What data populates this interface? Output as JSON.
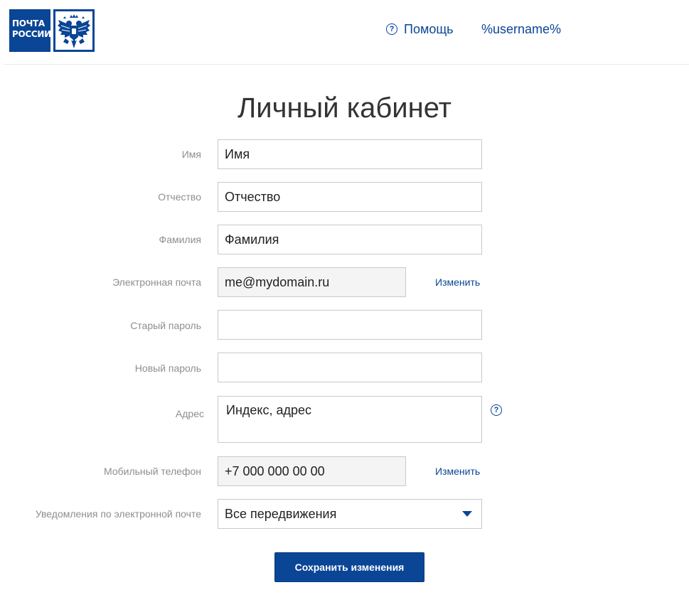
{
  "header": {
    "logo_text_line1": "ПОЧТА",
    "logo_text_line2": "РОССИИ",
    "help_icon": "question-circle-icon",
    "help_label": "Помощь",
    "username": "%username%"
  },
  "page": {
    "title": "Личный кабинет"
  },
  "form": {
    "first_name": {
      "label": "Имя",
      "value": "Имя"
    },
    "patronymic": {
      "label": "Отчество",
      "value": "Отчество"
    },
    "last_name": {
      "label": "Фамилия",
      "value": "Фамилия"
    },
    "email": {
      "label": "Электронная почта",
      "value": "me@mydomain.ru",
      "change_label": "Изменить"
    },
    "old_password": {
      "label": "Старый пароль",
      "value": ""
    },
    "new_password": {
      "label": "Новый пароль",
      "value": ""
    },
    "address": {
      "label": "Адрес",
      "value": "Индекс, адрес",
      "help_icon": "question-circle-icon"
    },
    "phone": {
      "label": "Мобильный телефон",
      "value": "+7 000 000 00 00",
      "change_label": "Изменить"
    },
    "notifications": {
      "label": "Уведомления по электронной почте",
      "selected": "Все передвижения",
      "arrow_icon": "caret-down-icon"
    },
    "save_label": "Сохранить изменения"
  },
  "colors": {
    "brand_blue": "#0a4596",
    "label_gray": "#8e8e8e",
    "readonly_bg": "#f4f4f4",
    "border": "#c9c9c9"
  }
}
